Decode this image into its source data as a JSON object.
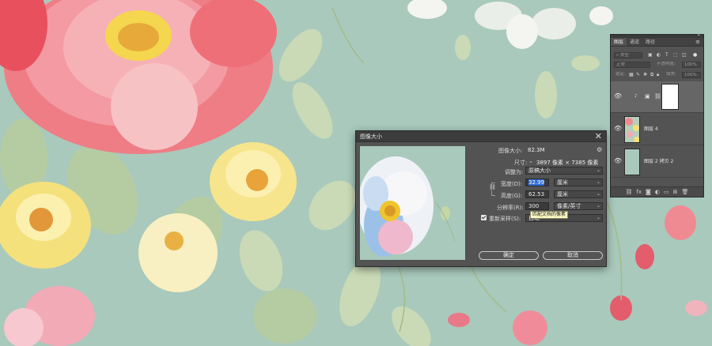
{
  "dialog": {
    "title": "图像大小",
    "close_glyph": "✕",
    "image_size_label": "图像大小:",
    "image_size_value": "82.3M",
    "dimensions_label": "尺寸:",
    "dimensions_value": "3897 像素 × 7385 像素",
    "fit_to_label": "调整为:",
    "fit_to_value": "原稿大小",
    "width_label": "宽度(D):",
    "width_value": "32.99",
    "width_unit": "厘米",
    "height_label": "高度(G):",
    "height_value": "62.53",
    "height_unit": "厘米",
    "resolution_label": "分辨率(R):",
    "resolution_value": "300",
    "resolution_unit": "像素/英寸",
    "resample_label": "重新采样(S):",
    "resample_value": "自动",
    "resample_checked": true,
    "tooltip": "匹配文档的像素",
    "ok_label": "确定",
    "cancel_label": "取消",
    "gear_icon": "gear-icon"
  },
  "layers_panel": {
    "tabs": [
      "图层",
      "通道",
      "路径"
    ],
    "active_tab": 0,
    "filter_kind_label": "类型",
    "blend_mode": "正常",
    "opacity_label": "不透明度:",
    "opacity_value": "100%",
    "lock_label": "锁定:",
    "fill_label": "填充:",
    "fill_value": "100%",
    "layers": [
      {
        "name": "",
        "type": "adjustment-with-mask",
        "visible": true,
        "selected": true
      },
      {
        "name": "图层 4",
        "type": "pattern",
        "visible": true,
        "selected": false
      },
      {
        "name": "图层 2 拷贝 2",
        "type": "solid",
        "visible": true,
        "selected": false
      }
    ],
    "bottom_icons": [
      "link-icon",
      "fx-icon",
      "mask-icon",
      "adjustment-icon",
      "folder-icon",
      "new-layer-icon",
      "trash-icon"
    ]
  },
  "colors": {
    "canvas_bg": "#a9c9bc",
    "dialog_bg": "#535353",
    "selection_blue": "#2d6bd6",
    "tooltip_bg": "#fbf6c2"
  }
}
